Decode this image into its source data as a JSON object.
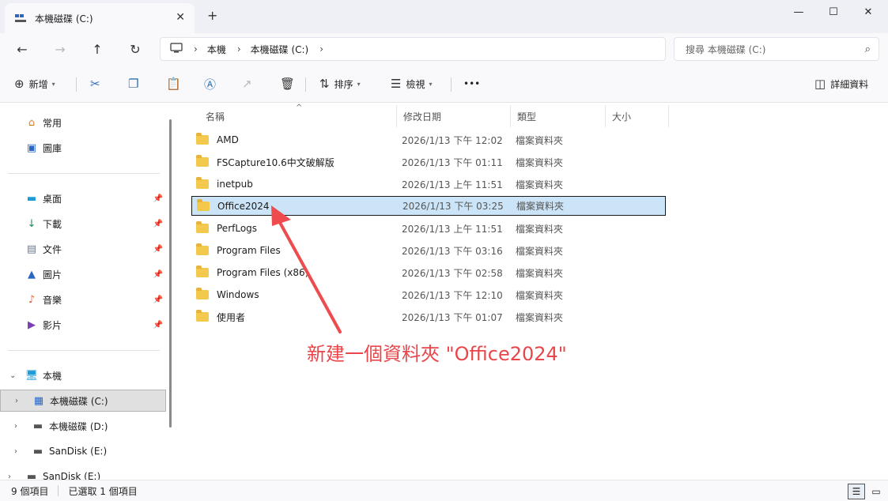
{
  "window": {
    "tab_title": "本機磁碟 (C:)",
    "new_tab": "+",
    "minimize": "—",
    "maximize": "☐",
    "close": "✕"
  },
  "nav": {
    "back": "←",
    "forward": "→",
    "up": "↑",
    "refresh": "↻",
    "breadcrumb": [
      "本機",
      "本機磁碟 (C:)"
    ],
    "search_placeholder": "搜尋 本機磁碟 (C:)"
  },
  "toolbar": {
    "new_label": "新增",
    "sort_label": "排序",
    "view_label": "檢視",
    "more_label": "•••",
    "details_label": "詳細資料"
  },
  "sidebar": {
    "quick": [
      {
        "label": "常用",
        "icon": "home-icon"
      },
      {
        "label": "圖庫",
        "icon": "gallery-icon"
      }
    ],
    "pinned": [
      {
        "label": "桌面",
        "icon": "desktop-icon"
      },
      {
        "label": "下載",
        "icon": "download-icon"
      },
      {
        "label": "文件",
        "icon": "document-icon"
      },
      {
        "label": "圖片",
        "icon": "pictures-icon"
      },
      {
        "label": "音樂",
        "icon": "music-icon"
      },
      {
        "label": "影片",
        "icon": "video-icon"
      }
    ],
    "tree": [
      {
        "label": "本機",
        "icon": "pc-icon"
      },
      {
        "label": "本機磁碟 (C:)",
        "icon": "drive-icon"
      },
      {
        "label": "本機磁碟 (D:)",
        "icon": "drive-icon"
      },
      {
        "label": "SanDisk (E:)",
        "icon": "drive-icon"
      },
      {
        "label": "SanDisk (E:)",
        "icon": "drive-icon"
      }
    ]
  },
  "columns": {
    "name": "名稱",
    "date": "修改日期",
    "type": "類型",
    "size": "大小"
  },
  "files": [
    {
      "name": "AMD",
      "date": "2026/1/13 下午 12:02",
      "type": "檔案資料夾"
    },
    {
      "name": "FSCapture10.6中文破解版",
      "date": "2026/1/13 下午 01:11",
      "type": "檔案資料夾"
    },
    {
      "name": "inetpub",
      "date": "2026/1/13 上午 11:51",
      "type": "檔案資料夾"
    },
    {
      "name": "Office2024",
      "date": "2026/1/13 下午 03:25",
      "type": "檔案資料夾"
    },
    {
      "name": "PerfLogs",
      "date": "2026/1/13 上午 11:51",
      "type": "檔案資料夾"
    },
    {
      "name": "Program Files",
      "date": "2026/1/13 下午 03:16",
      "type": "檔案資料夾"
    },
    {
      "name": "Program Files (x86)",
      "date": "2026/1/13 下午 02:58",
      "type": "檔案資料夾"
    },
    {
      "name": "Windows",
      "date": "2026/1/13 下午 12:10",
      "type": "檔案資料夾"
    },
    {
      "name": "使用者",
      "date": "2026/1/13 下午 01:07",
      "type": "檔案資料夾"
    }
  ],
  "annotation": {
    "text": "新建一個資料夾 \"Office2024\"",
    "color": "#e8464a"
  },
  "status": {
    "count": "9 個項目",
    "selected": "已選取 1 個項目"
  }
}
